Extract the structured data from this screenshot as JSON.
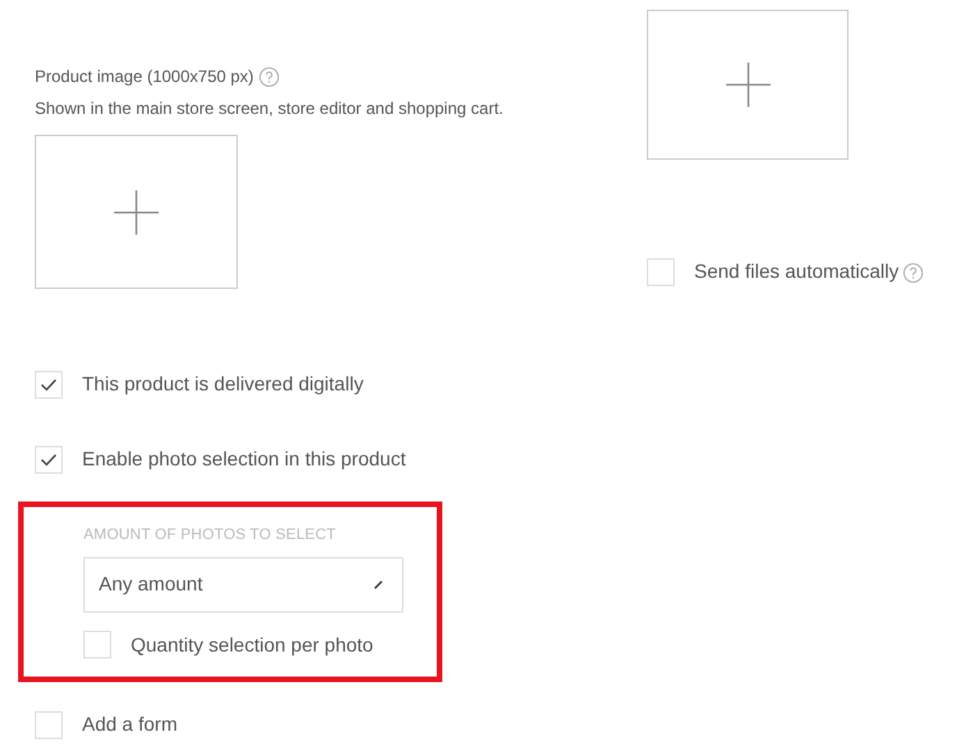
{
  "product_image": {
    "label": "Product image (1000x750 px)",
    "description": "Shown in the main store screen, store editor and shopping cart."
  },
  "send_files": {
    "label": "Send files automatically",
    "checked": false
  },
  "options": [
    {
      "label": "This product is delivered digitally",
      "checked": true
    },
    {
      "label": "Enable photo selection in this product",
      "checked": true
    }
  ],
  "photo_selection": {
    "heading": "AMOUNT OF PHOTOS TO SELECT",
    "select": {
      "value": "Any amount"
    },
    "option": {
      "label": "Quantity selection per photo",
      "checked": false
    }
  },
  "form_option": {
    "label": "Add a form",
    "checked": false
  }
}
